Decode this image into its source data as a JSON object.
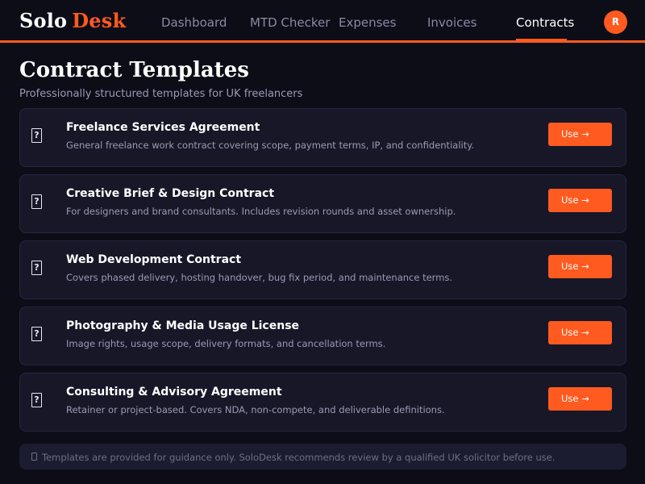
{
  "brand": {
    "part1": "Solo",
    "part2": "Desk"
  },
  "nav": {
    "items": [
      {
        "label": "Dashboard"
      },
      {
        "label": "MTD Checker"
      },
      {
        "label": "Expenses"
      },
      {
        "label": "Invoices"
      },
      {
        "label": "Contracts",
        "active": true
      }
    ]
  },
  "user": {
    "avatar_initial": "R"
  },
  "page": {
    "title": "Contract Templates",
    "subtitle": "Professionally structured templates for UK freelancers"
  },
  "templates": [
    {
      "title": "Freelance Services Agreement",
      "description": "General freelance work contract covering scope, payment terms, IP, and confidentiality.",
      "button": "Use →"
    },
    {
      "title": "Creative Brief & Design Contract",
      "description": "For designers and brand consultants. Includes revision rounds and asset ownership.",
      "button": "Use →"
    },
    {
      "title": "Web Development Contract",
      "description": "Covers phased delivery, hosting handover, bug fix period, and maintenance terms.",
      "button": "Use →"
    },
    {
      "title": "Photography & Media Usage License",
      "description": "Image rights, usage scope, delivery formats, and cancellation terms.",
      "button": "Use →"
    },
    {
      "title": "Consulting & Advisory Agreement",
      "description": "Retainer or project-based. Covers NDA, non-compete, and deliverable definitions.",
      "button": "Use →"
    }
  ],
  "icons": {
    "template_icon": "document-icon",
    "disclaimer_icon": "info-icon"
  },
  "disclaimer": "Templates are provided for guidance only. SoloDesk recommends review by a qualified UK solicitor before use.",
  "colors": {
    "accent": "#ff5a1f",
    "background": "#0d0d18",
    "card": "#171728"
  }
}
